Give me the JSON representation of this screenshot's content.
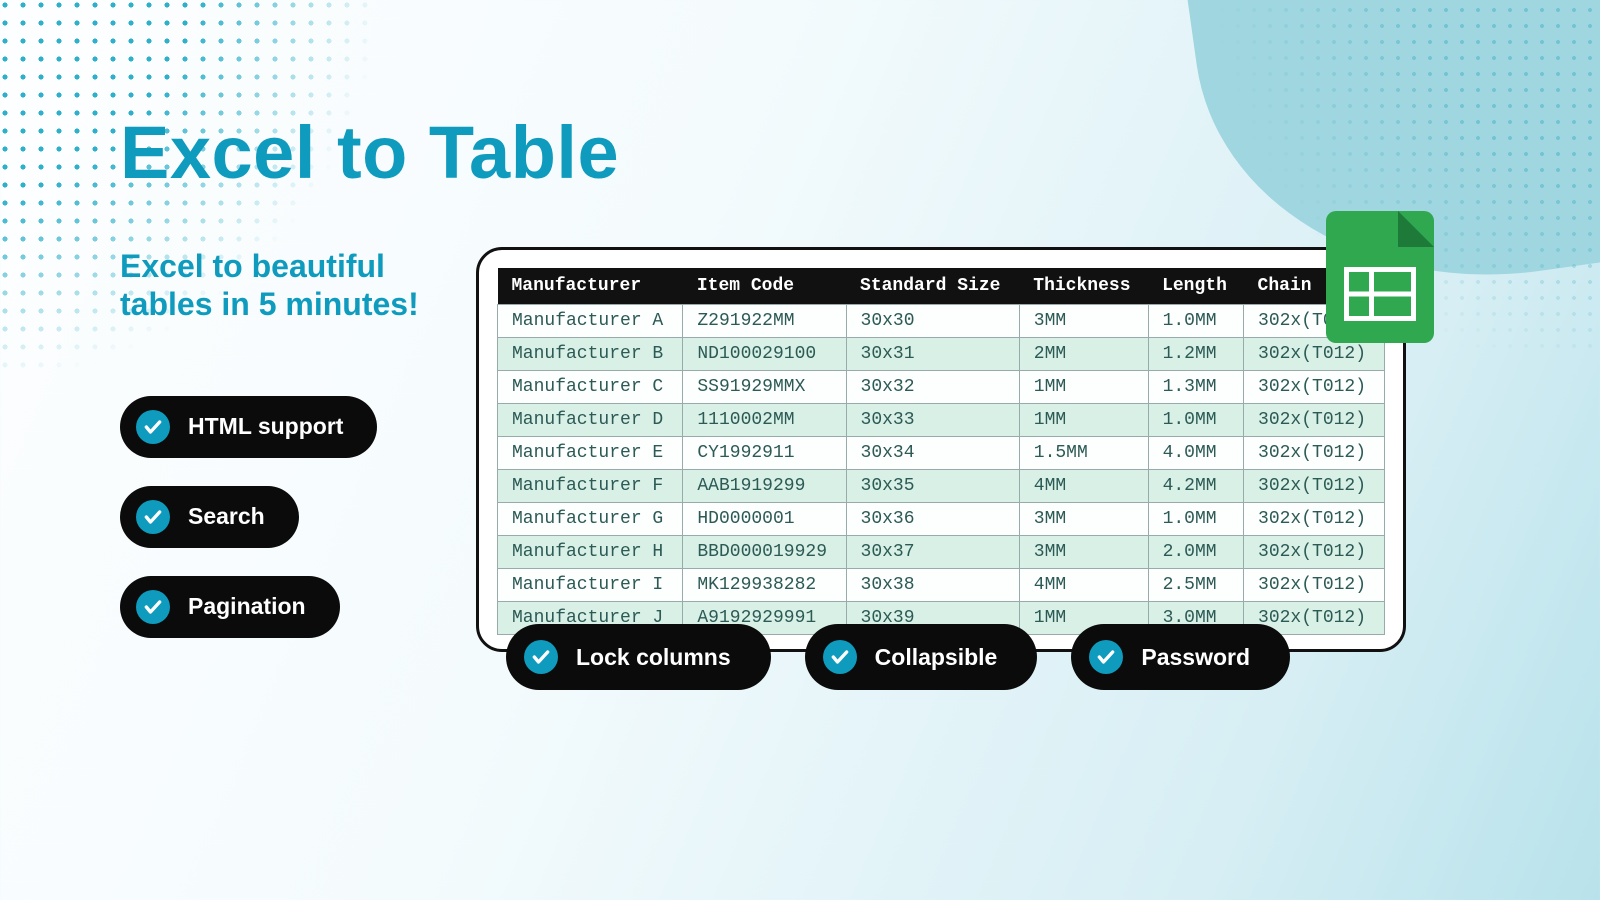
{
  "title": "Excel to Table",
  "subtitle": "Excel to beautiful tables in 5 minutes!",
  "leftPills": [
    {
      "label": "HTML support"
    },
    {
      "label": "Search"
    },
    {
      "label": "Pagination"
    }
  ],
  "bottomPills": [
    {
      "label": "Lock columns"
    },
    {
      "label": "Collapsible"
    },
    {
      "label": "Password"
    }
  ],
  "table": {
    "headers": [
      "Manufacturer",
      "Item Code",
      "Standard Size",
      "Thickness",
      "Length",
      "Chain"
    ],
    "rows": [
      [
        "Manufacturer A",
        "Z291922MM",
        "30x30",
        "3MM",
        "1.0MM",
        "302x(T012)"
      ],
      [
        "Manufacturer B",
        "ND100029100",
        "30x31",
        "2MM",
        "1.2MM",
        "302x(T012)"
      ],
      [
        "Manufacturer C",
        "SS91929MMX",
        "30x32",
        "1MM",
        "1.3MM",
        "302x(T012)"
      ],
      [
        "Manufacturer D",
        "1110002MM",
        "30x33",
        "1MM",
        "1.0MM",
        "302x(T012)"
      ],
      [
        "Manufacturer E",
        "CY1992911",
        "30x34",
        "1.5MM",
        "4.0MM",
        "302x(T012)"
      ],
      [
        "Manufacturer F",
        "AAB1919299",
        "30x35",
        "4MM",
        "4.2MM",
        "302x(T012)"
      ],
      [
        "Manufacturer G",
        "HD0000001",
        "30x36",
        "3MM",
        "1.0MM",
        "302x(T012)"
      ],
      [
        "Manufacturer H",
        "BBD000019929",
        "30x37",
        "3MM",
        "2.0MM",
        "302x(T012)"
      ],
      [
        "Manufacturer I",
        "MK129938282",
        "30x38",
        "4MM",
        "2.5MM",
        "302x(T012)"
      ],
      [
        "Manufacturer J",
        "A9192929991",
        "30x39",
        "1MM",
        "3.0MM",
        "302x(T012)"
      ]
    ]
  },
  "colors": {
    "accent": "#0f9bbd",
    "pillBg": "#0b0b0b",
    "evenRow": "#d9f0e6",
    "sheetsGreen": "#2fa84f"
  }
}
